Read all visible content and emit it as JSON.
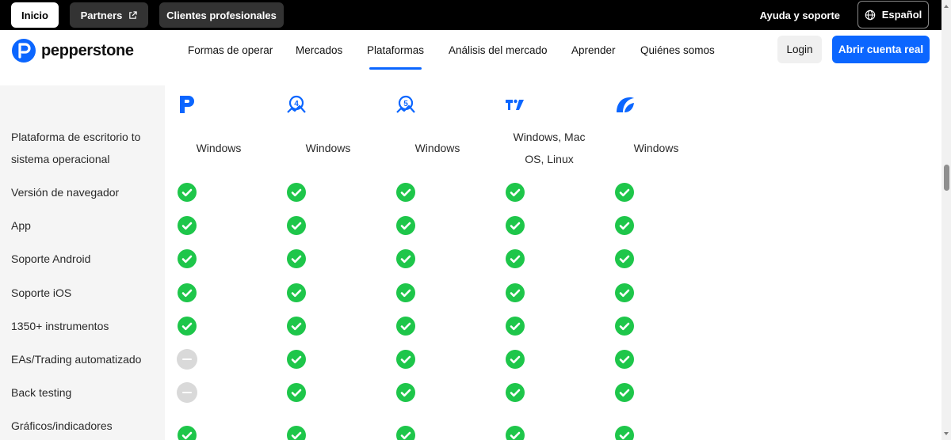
{
  "topbar": {
    "inicio": "Inicio",
    "partners": "Partners",
    "clientes": "Clientes profesionales",
    "ayuda": "Ayuda y soporte",
    "language": "Español"
  },
  "nav": {
    "logo_text": "pepperstone",
    "items": [
      "Formas de operar",
      "Mercados",
      "Plataformas",
      "Análisis del mercado",
      "Aprender",
      "Quiénes somos"
    ],
    "active_item": "Plataformas",
    "login": "Login",
    "cta": "Abrir cuenta real"
  },
  "colors": {
    "brand_blue": "#0b66ff",
    "check_green": "#1ec64a",
    "unavailable_gray": "#d9d9d9"
  },
  "platform_icons": [
    "pepperstone-icon",
    "metatrader4-icon",
    "metatrader5-icon",
    "tradingview-icon",
    "ctrader-icon"
  ],
  "table": {
    "os_row_label": "Plataforma de escritorio to sistema operacional",
    "os_values": [
      "Windows",
      "Windows",
      "Windows",
      "Windows, Mac OS, Linux",
      "Windows"
    ],
    "feature_rows": [
      {
        "label": "Versión de navegador",
        "values": [
          true,
          true,
          true,
          true,
          true
        ]
      },
      {
        "label": "App",
        "values": [
          true,
          true,
          true,
          true,
          true
        ]
      },
      {
        "label": "Soporte Android",
        "values": [
          true,
          true,
          true,
          true,
          true
        ]
      },
      {
        "label": "Soporte iOS",
        "values": [
          true,
          true,
          true,
          true,
          true
        ]
      },
      {
        "label": "1350+ instrumentos",
        "values": [
          true,
          true,
          true,
          true,
          true
        ]
      },
      {
        "label": "EAs/Trading automatizado",
        "values": [
          false,
          true,
          true,
          true,
          true
        ]
      },
      {
        "label": "Back testing",
        "values": [
          false,
          true,
          true,
          true,
          true
        ]
      },
      {
        "label": "Gráficos/indicadores",
        "values": [
          true,
          true,
          true,
          true,
          true
        ]
      }
    ]
  }
}
